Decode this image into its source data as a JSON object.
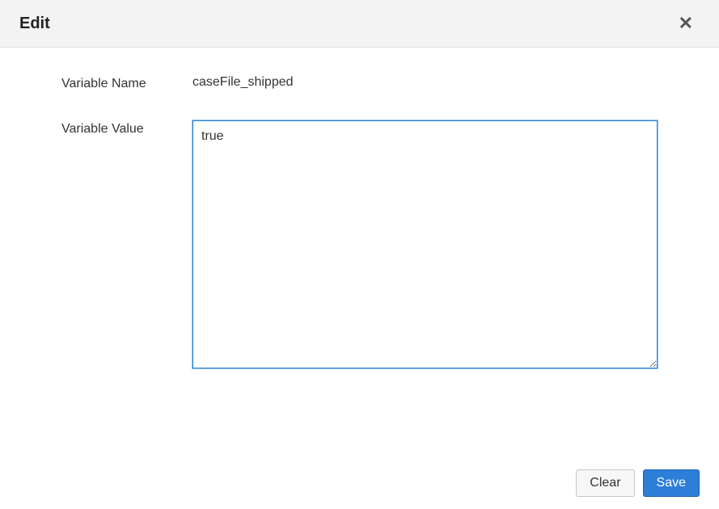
{
  "header": {
    "title": "Edit"
  },
  "form": {
    "name_label": "Variable Name",
    "name_value": "caseFile_shipped",
    "value_label": "Variable Value",
    "value_input": "true"
  },
  "footer": {
    "clear_label": "Clear",
    "save_label": "Save"
  }
}
